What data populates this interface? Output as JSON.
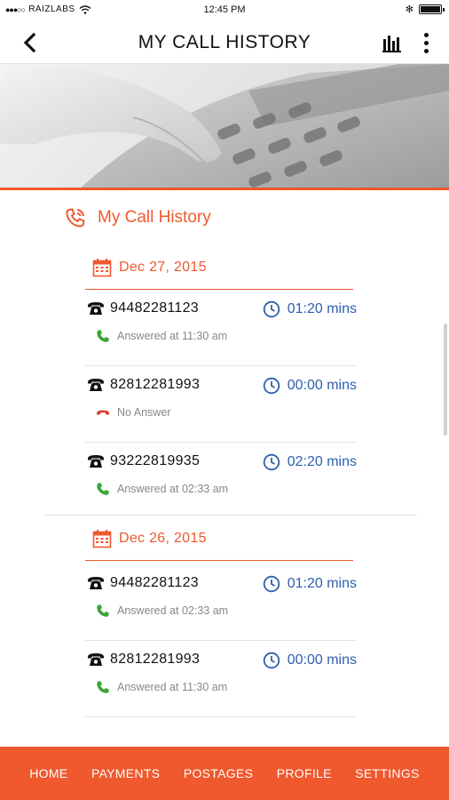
{
  "status_bar": {
    "signal": "●●●○○",
    "carrier": "RAIZLABS",
    "time": "12:45 PM",
    "bluetooth": "✻"
  },
  "header": {
    "title": "MY CALL HISTORY"
  },
  "section": {
    "title": "My Call History"
  },
  "groups": [
    {
      "date": "Dec 27, 2015",
      "calls": [
        {
          "number": "94482281123",
          "duration": "01:20 mins",
          "status": "Answered at  11:30 am",
          "type": "answered"
        },
        {
          "number": "82812281993",
          "duration": "00:00 mins",
          "status": "No Answer",
          "type": "missed"
        },
        {
          "number": "93222819935",
          "duration": "02:20 mins",
          "status": "Answered at  02:33 am",
          "type": "answered"
        }
      ]
    },
    {
      "date": "Dec 26, 2015",
      "calls": [
        {
          "number": "94482281123",
          "duration": "01:20 mins",
          "status": "Answered at  02:33 am",
          "type": "answered"
        },
        {
          "number": "82812281993",
          "duration": "00:00 mins",
          "status": "Answered at  11:30 am",
          "type": "answered"
        }
      ]
    }
  ],
  "nav": [
    "HOME",
    "PAYMENTS",
    "POSTAGES",
    "PROFILE",
    "SETTINGS"
  ],
  "colors": {
    "accent": "#f0582e",
    "duration": "#2e5fae",
    "answered": "#3aa636",
    "missed": "#e03a2a"
  }
}
